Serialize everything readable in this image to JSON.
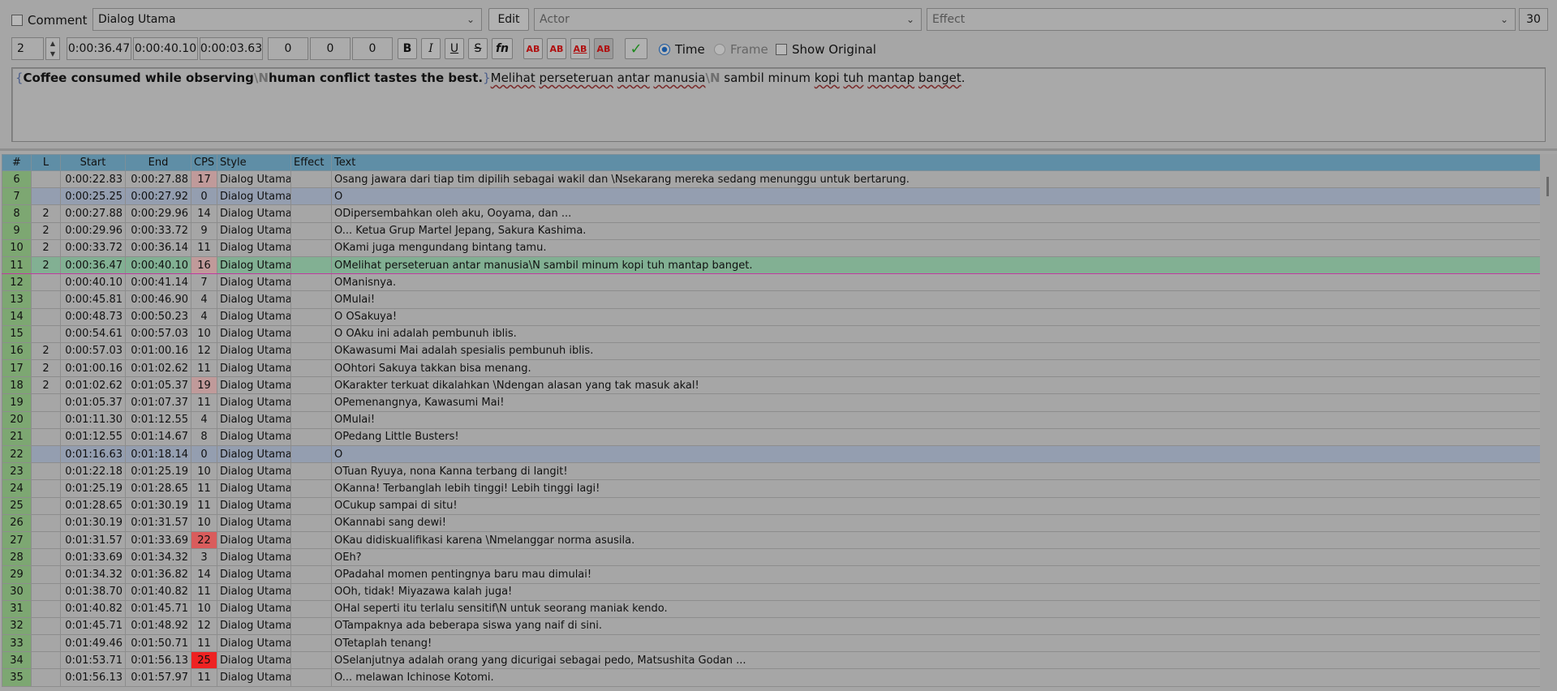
{
  "toolbar_top": {
    "comment_label": "Comment",
    "style_value": "Dialog Utama",
    "edit_label": "Edit",
    "actor_placeholder": "Actor",
    "effect_placeholder": "Effect",
    "layer_value": "30"
  },
  "toolbar_timing": {
    "layer": "2",
    "start_time": "0:00:36.47",
    "end_time": "0:00:40.10",
    "duration": "0:00:03.63",
    "margin_left": "0",
    "margin_right": "0",
    "margin_vertical": "0",
    "bold_label": "B",
    "italic_label": "I",
    "underline_label": "U",
    "strike_label": "S",
    "fn_label": "fn",
    "color_labels": [
      "AB",
      "AB",
      "AB",
      "AB"
    ],
    "commit_label": "✓",
    "time_label": "Time",
    "frame_label": "Frame",
    "show_original_label": "Show Original"
  },
  "editor": {
    "open_brace": "{",
    "part1": "Coffee consumed while observing",
    "esc1": "\\N",
    "part2": "human conflict tastes the best.",
    "close_brace": "}",
    "part3": "Melihat",
    "part4": " ",
    "part5": "perseteruan",
    "part6": " ",
    "part7": "antar",
    "part8": " ",
    "part9": "manusia",
    "esc2": "\\N",
    "part10": " sambil minum ",
    "part11": "kopi",
    "part12": " ",
    "part13": "tuh",
    "part14": " ",
    "part15": "mantap",
    "part16": " ",
    "part17": "banget",
    "part18": "."
  },
  "grid": {
    "headers": [
      "#",
      "L",
      "Start",
      "End",
      "CPS",
      "Style",
      "Effect",
      "Text"
    ],
    "rows": [
      {
        "n": "6",
        "l": "",
        "start": "0:00:22.83",
        "end": "0:00:27.88",
        "cps": "17",
        "style": "Dialog Utama",
        "effect": "",
        "text": "Osang jawara dari tiap tim dipilih sebagai wakil dan \\Nsekarang mereka sedang menunggu untuk bertarung."
      },
      {
        "n": "7",
        "l": "",
        "start": "0:00:25.25",
        "end": "0:00:27.92",
        "cps": "0",
        "style": "Dialog Utama",
        "effect": "",
        "text": "O"
      },
      {
        "n": "8",
        "l": "2",
        "start": "0:00:27.88",
        "end": "0:00:29.96",
        "cps": "14",
        "style": "Dialog Utama",
        "effect": "",
        "text": "ODipersembahkan oleh aku, Ooyama, dan ..."
      },
      {
        "n": "9",
        "l": "2",
        "start": "0:00:29.96",
        "end": "0:00:33.72",
        "cps": "9",
        "style": "Dialog Utama",
        "effect": "",
        "text": "O... Ketua Grup Martel Jepang, Sakura Kashima."
      },
      {
        "n": "10",
        "l": "2",
        "start": "0:00:33.72",
        "end": "0:00:36.14",
        "cps": "11",
        "style": "Dialog Utama",
        "effect": "",
        "text": "OKami juga mengundang bintang tamu."
      },
      {
        "n": "11",
        "l": "2",
        "start": "0:00:36.47",
        "end": "0:00:40.10",
        "cps": "16",
        "style": "Dialog Utama",
        "effect": "",
        "text": "OMelihat perseteruan antar manusia\\N sambil minum kopi tuh mantap banget."
      },
      {
        "n": "12",
        "l": "",
        "start": "0:00:40.10",
        "end": "0:00:41.14",
        "cps": "7",
        "style": "Dialog Utama",
        "effect": "",
        "text": "OManisnya."
      },
      {
        "n": "13",
        "l": "",
        "start": "0:00:45.81",
        "end": "0:00:46.90",
        "cps": "4",
        "style": "Dialog Utama",
        "effect": "",
        "text": "OMulai!"
      },
      {
        "n": "14",
        "l": "",
        "start": "0:00:48.73",
        "end": "0:00:50.23",
        "cps": "4",
        "style": "Dialog Utama",
        "effect": "",
        "text": "O OSakuya!"
      },
      {
        "n": "15",
        "l": "",
        "start": "0:00:54.61",
        "end": "0:00:57.03",
        "cps": "10",
        "style": "Dialog Utama",
        "effect": "",
        "text": "O OAku ini adalah pembunuh iblis."
      },
      {
        "n": "16",
        "l": "2",
        "start": "0:00:57.03",
        "end": "0:01:00.16",
        "cps": "12",
        "style": "Dialog Utama",
        "effect": "",
        "text": "OKawasumi Mai adalah spesialis pembunuh iblis."
      },
      {
        "n": "17",
        "l": "2",
        "start": "0:01:00.16",
        "end": "0:01:02.62",
        "cps": "11",
        "style": "Dialog Utama",
        "effect": "",
        "text": "OOhtori Sakuya takkan bisa menang."
      },
      {
        "n": "18",
        "l": "2",
        "start": "0:01:02.62",
        "end": "0:01:05.37",
        "cps": "19",
        "style": "Dialog Utama",
        "effect": "",
        "text": "OKarakter terkuat dikalahkan \\Ndengan alasan yang tak masuk akal!"
      },
      {
        "n": "19",
        "l": "",
        "start": "0:01:05.37",
        "end": "0:01:07.37",
        "cps": "11",
        "style": "Dialog Utama",
        "effect": "",
        "text": "OPemenangnya, Kawasumi Mai!"
      },
      {
        "n": "20",
        "l": "",
        "start": "0:01:11.30",
        "end": "0:01:12.55",
        "cps": "4",
        "style": "Dialog Utama",
        "effect": "",
        "text": "OMulai!"
      },
      {
        "n": "21",
        "l": "",
        "start": "0:01:12.55",
        "end": "0:01:14.67",
        "cps": "8",
        "style": "Dialog Utama",
        "effect": "",
        "text": "OPedang Little Busters!"
      },
      {
        "n": "22",
        "l": "",
        "start": "0:01:16.63",
        "end": "0:01:18.14",
        "cps": "0",
        "style": "Dialog Utama",
        "effect": "",
        "text": "O"
      },
      {
        "n": "23",
        "l": "",
        "start": "0:01:22.18",
        "end": "0:01:25.19",
        "cps": "10",
        "style": "Dialog Utama",
        "effect": "",
        "text": "OTuan Ryuya, nona Kanna terbang di langit!"
      },
      {
        "n": "24",
        "l": "",
        "start": "0:01:25.19",
        "end": "0:01:28.65",
        "cps": "11",
        "style": "Dialog Utama",
        "effect": "",
        "text": "OKanna! Terbanglah lebih tinggi! Lebih tinggi lagi!"
      },
      {
        "n": "25",
        "l": "",
        "start": "0:01:28.65",
        "end": "0:01:30.19",
        "cps": "11",
        "style": "Dialog Utama",
        "effect": "",
        "text": "OCukup sampai di situ!"
      },
      {
        "n": "26",
        "l": "",
        "start": "0:01:30.19",
        "end": "0:01:31.57",
        "cps": "10",
        "style": "Dialog Utama",
        "effect": "",
        "text": "OKannabi sang dewi!"
      },
      {
        "n": "27",
        "l": "",
        "start": "0:01:31.57",
        "end": "0:01:33.69",
        "cps": "22",
        "style": "Dialog Utama",
        "effect": "",
        "text": "OKau didiskualifikasi karena \\Nmelanggar norma asusila."
      },
      {
        "n": "28",
        "l": "",
        "start": "0:01:33.69",
        "end": "0:01:34.32",
        "cps": "3",
        "style": "Dialog Utama",
        "effect": "",
        "text": "OEh?"
      },
      {
        "n": "29",
        "l": "",
        "start": "0:01:34.32",
        "end": "0:01:36.82",
        "cps": "14",
        "style": "Dialog Utama",
        "effect": "",
        "text": "OPadahal momen pentingnya baru mau dimulai!"
      },
      {
        "n": "30",
        "l": "",
        "start": "0:01:38.70",
        "end": "0:01:40.82",
        "cps": "11",
        "style": "Dialog Utama",
        "effect": "",
        "text": "OOh, tidak! Miyazawa kalah juga!"
      },
      {
        "n": "31",
        "l": "",
        "start": "0:01:40.82",
        "end": "0:01:45.71",
        "cps": "10",
        "style": "Dialog Utama",
        "effect": "",
        "text": "OHal seperti itu terlalu sensitif\\N untuk seorang maniak kendo."
      },
      {
        "n": "32",
        "l": "",
        "start": "0:01:45.71",
        "end": "0:01:48.92",
        "cps": "12",
        "style": "Dialog Utama",
        "effect": "",
        "text": "OTampaknya ada beberapa siswa yang naif di sini."
      },
      {
        "n": "33",
        "l": "",
        "start": "0:01:49.46",
        "end": "0:01:50.71",
        "cps": "11",
        "style": "Dialog Utama",
        "effect": "",
        "text": "OTetaplah tenang!"
      },
      {
        "n": "34",
        "l": "",
        "start": "0:01:53.71",
        "end": "0:01:56.13",
        "cps": "25",
        "style": "Dialog Utama",
        "effect": "",
        "text": "OSelanjutnya adalah orang yang dicurigai sebagai pedo, Matsushita Godan ..."
      },
      {
        "n": "35",
        "l": "",
        "start": "0:01:56.13",
        "end": "0:01:57.97",
        "cps": "11",
        "style": "Dialog Utama",
        "effect": "",
        "text": "O... melawan Ichinose Kotomi."
      }
    ]
  }
}
